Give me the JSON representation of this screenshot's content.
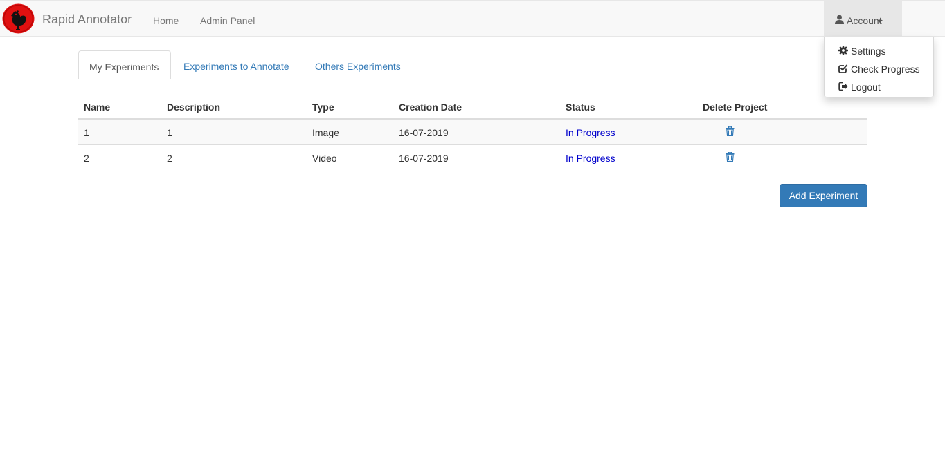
{
  "navbar": {
    "brand": "Rapid Annotator",
    "links": [
      "Home",
      "Admin Panel"
    ],
    "account_label": "Account"
  },
  "account_menu": {
    "items": [
      {
        "label": "Settings",
        "icon": "gear-icon"
      },
      {
        "label": "Check Progress",
        "icon": "check-square-icon"
      },
      {
        "label": "Logout",
        "icon": "logout-icon"
      }
    ]
  },
  "tabs": [
    "My Experiments",
    "Experiments to Annotate",
    "Others Experiments"
  ],
  "active_tab": "My Experiments",
  "table": {
    "headers": [
      "Name",
      "Description",
      "Type",
      "Creation Date",
      "Status",
      "Delete Project"
    ],
    "rows": [
      {
        "name": "1",
        "description": "1",
        "type": "Image",
        "creation_date": "16-07-2019",
        "status": "In Progress"
      },
      {
        "name": "2",
        "description": "2",
        "type": "Video",
        "creation_date": "16-07-2019",
        "status": "In Progress"
      }
    ]
  },
  "add_button": "Add Experiment",
  "colors": {
    "primary": "#337ab7",
    "status_link": "#0000cc",
    "logo_red": "#e01010"
  }
}
